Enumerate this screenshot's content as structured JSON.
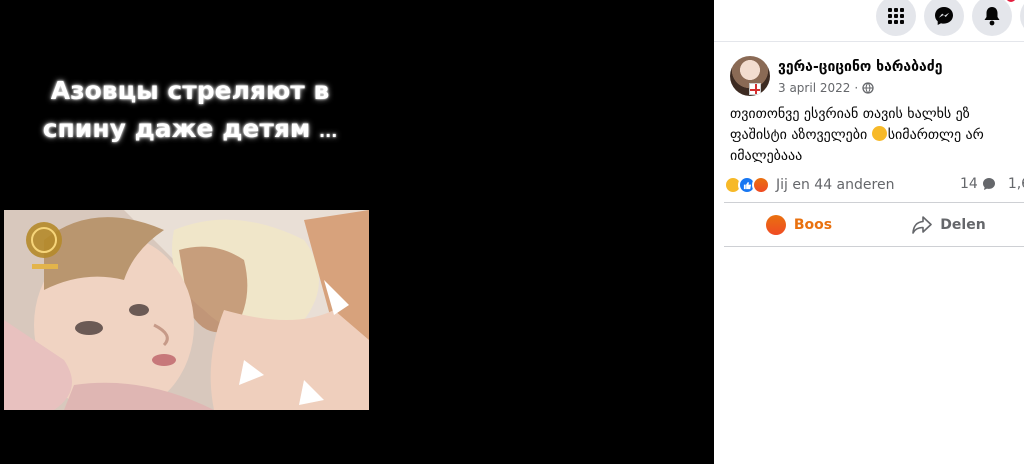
{
  "media": {
    "caption_line1": "Азовцы стреляют в",
    "caption_line2": "спину даже детям",
    "caption_ellipsis": "..."
  },
  "topbar": {
    "icons": [
      "apps-grid-icon",
      "messenger-icon",
      "notifications-bell-icon",
      "account-icon"
    ]
  },
  "post": {
    "author": "ვერა-ციცინო ხარაბაძე",
    "date": "3 april 2022",
    "separator": "·",
    "audience_icon": "globe-icon",
    "text_part1": "თვითონვე ესვრიან თავის ხალხს ეზ ფაშისტი აზოველები ",
    "text_part2": "სიმართლე არ იმალებააა",
    "reactions": [
      "sad",
      "like",
      "angry"
    ],
    "reactions_text": "Jij en 44 anderen",
    "comments_count": "14",
    "shares_count": "1,6",
    "actions": {
      "boos": "Boos",
      "share": "Delen"
    }
  },
  "colors": {
    "accent_angry": "#e9710f",
    "facebook_blue": "#1877f2",
    "muted_text": "#65676b"
  }
}
